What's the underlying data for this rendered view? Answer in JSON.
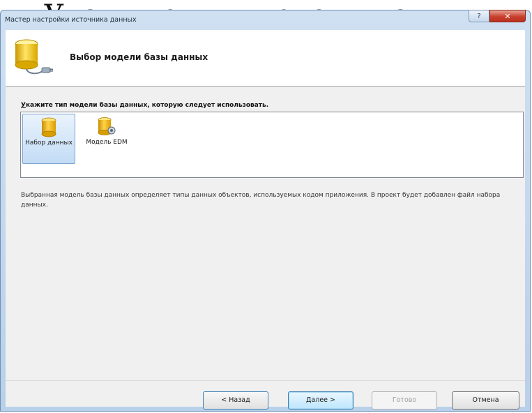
{
  "caption": "Укажите тип модели данных",
  "window": {
    "title": "Мастер настройки источника данных",
    "help_glyph": "?",
    "close_glyph": "✕"
  },
  "header": {
    "title": "Выбор модели базы данных",
    "icon": "database-connection-icon"
  },
  "prompt": {
    "accel": "У",
    "rest": "кажите тип модели базы данных, которую следует использовать."
  },
  "models": [
    {
      "label": "Набор данных",
      "icon": "dataset-icon",
      "selected": true
    },
    {
      "label": "Модель EDM",
      "icon": "edm-model-icon",
      "selected": false
    }
  ],
  "description": "Выбранная модель базы данных определяет типы данных объектов, используемых кодом приложения. В проект будет добавлен файл набора данных.",
  "buttons": {
    "back": "< Назад",
    "next": "Далее >",
    "finish": "Готово",
    "cancel": "Отмена",
    "finish_enabled": false
  },
  "colors": {
    "titlebar": "#c4d8ee",
    "selection": "#c2dcf5",
    "db_yellow": "#e8b800",
    "close_red": "#c9402c"
  }
}
